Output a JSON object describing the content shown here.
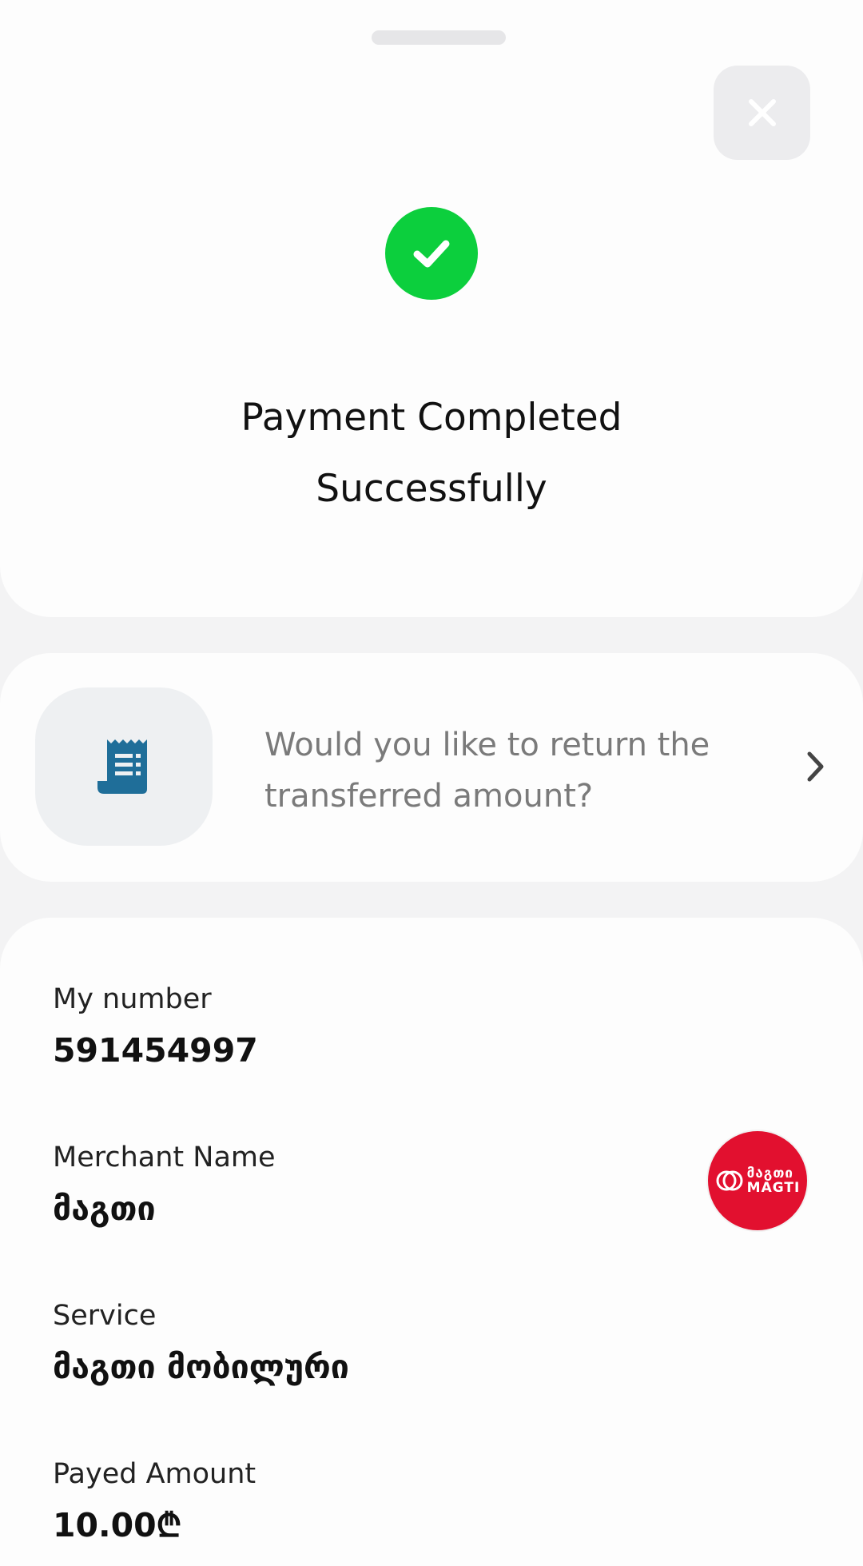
{
  "header": {
    "title_line1": "Payment Completed",
    "title_line2": "Successfully",
    "close_icon": "close-icon",
    "status_icon": "check-circle-icon",
    "status_color": "#0ccf3d"
  },
  "refund": {
    "text": "Would you like to return the transferred amount?",
    "icon": "receipt-icon",
    "icon_color": "#1f6e99"
  },
  "details": {
    "my_number_label": "My number",
    "my_number_value": "591454997",
    "merchant_label": "Merchant Name",
    "merchant_value": "მაგთი",
    "merchant_logo_text_ge": "მაგთი",
    "merchant_logo_text_en": "MAGTI",
    "merchant_logo_color": "#e2102f",
    "service_label": "Service",
    "service_value": "მაგთი მობილური",
    "amount_label": "Payed Amount",
    "amount_value": "10.00₾"
  }
}
